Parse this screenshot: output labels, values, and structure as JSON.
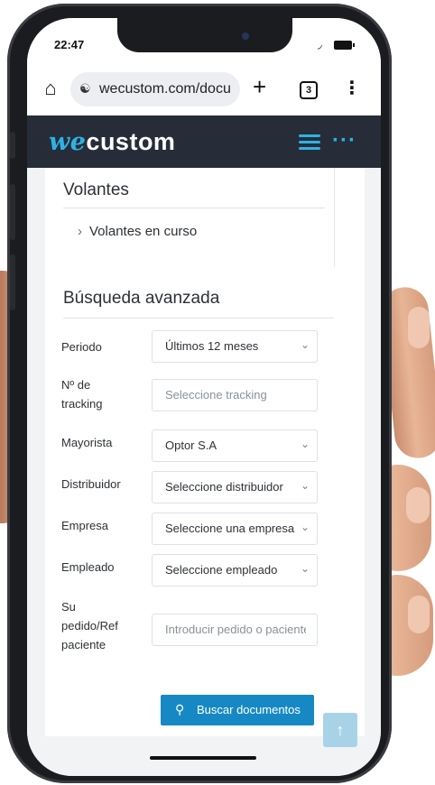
{
  "status_bar": {
    "time": "22:47",
    "battery_icon": "battery-icon",
    "wifi_icon": "wifi-icon"
  },
  "browser": {
    "url": "wecustom.com/docu",
    "tab_count": "3",
    "icons": [
      "home-icon",
      "site-settings-icon",
      "plus-icon",
      "tabs-icon",
      "more-vert-icon"
    ]
  },
  "header": {
    "logo_we": "we",
    "logo_custom": "custom",
    "accent_color": "#2fb1e4",
    "bg_color": "#262d38"
  },
  "volantes": {
    "title": "Volantes",
    "link": "Volantes en curso"
  },
  "advanced_search": {
    "title": "Búsqueda avanzada",
    "fields": [
      {
        "label": "Periodo",
        "value": "Últimos 12 meses",
        "type": "select"
      },
      {
        "label": "Nº de tracking",
        "value": "Seleccione tracking",
        "type": "input"
      },
      {
        "label": "Mayorista",
        "value": "Optor S.A",
        "type": "select"
      },
      {
        "label": "Distribuidor",
        "value": "Seleccione distribuidor",
        "type": "select"
      },
      {
        "label": "Empresa",
        "value": "Seleccione una empresa",
        "type": "select"
      },
      {
        "label": "Empleado",
        "value": "Seleccione empleado",
        "type": "select"
      },
      {
        "label": "Su pedido/Ref paciente",
        "value": "Introducir pedido o paciente",
        "type": "input"
      }
    ],
    "search_button": "Buscar documentos",
    "button_color": "#1689c4"
  }
}
